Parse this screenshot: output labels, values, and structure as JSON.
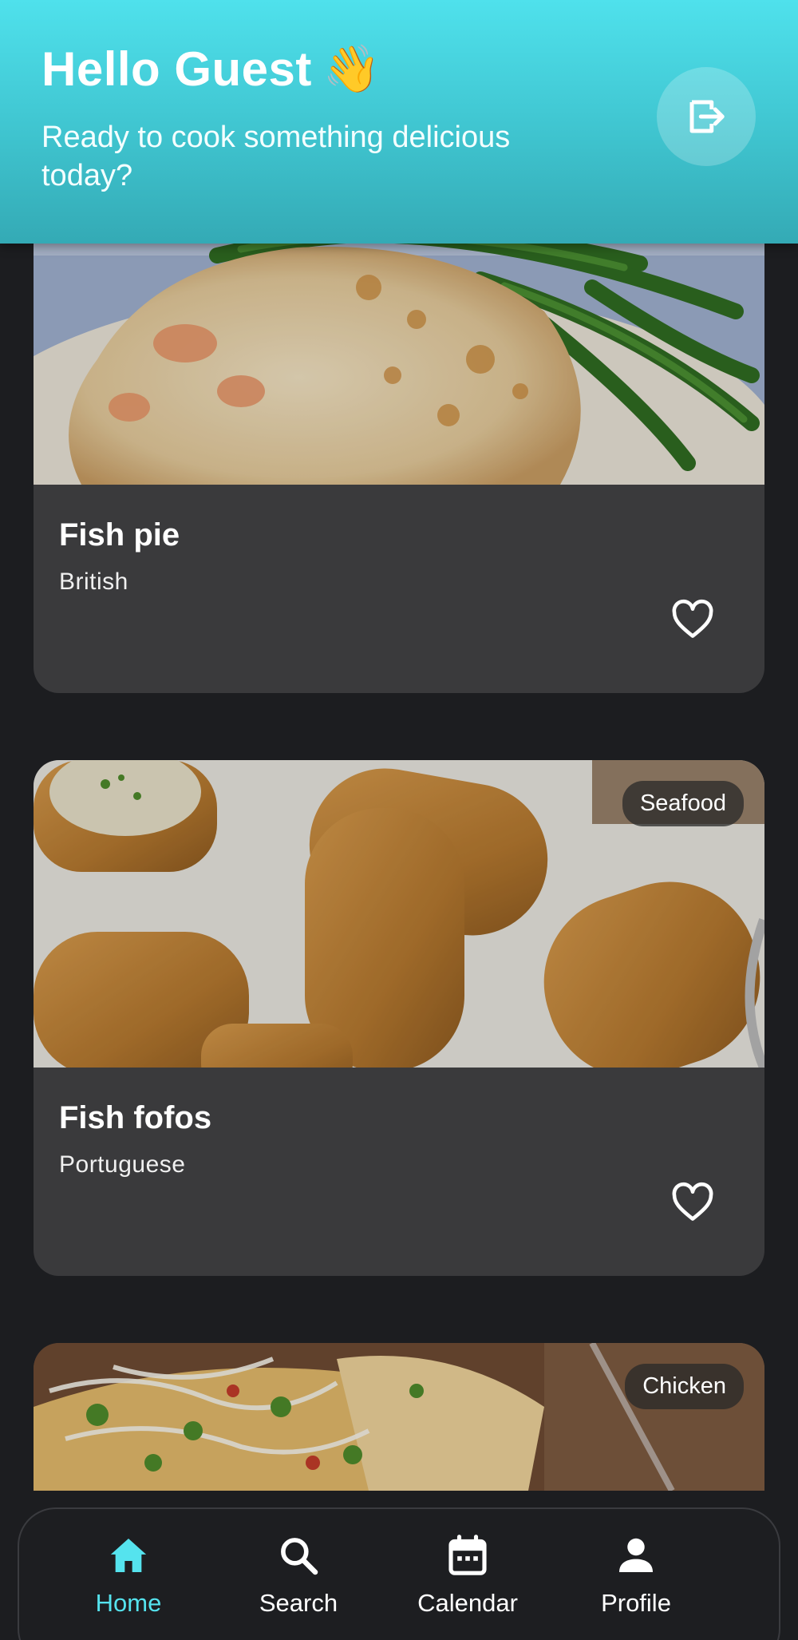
{
  "header": {
    "greeting": "Hello Guest",
    "wave_emoji": "👋",
    "subtitle": "Ready to cook something delicious today?",
    "logout_icon": "logout-icon"
  },
  "recipes": [
    {
      "title": "Fish pie",
      "cuisine": "British",
      "tag": ""
    },
    {
      "title": "Fish fofos",
      "cuisine": "Portuguese",
      "tag": "Seafood"
    },
    {
      "title": "",
      "cuisine": "",
      "tag": "Chicken"
    }
  ],
  "nav": {
    "items": [
      {
        "label": "Home",
        "icon": "home-icon",
        "active": true
      },
      {
        "label": "Search",
        "icon": "search-icon",
        "active": false
      },
      {
        "label": "Calendar",
        "icon": "calendar-icon",
        "active": false
      },
      {
        "label": "Profile",
        "icon": "profile-icon",
        "active": false
      }
    ]
  },
  "colors": {
    "header_accent": "#4fe1ec",
    "active_nav": "#55e3ee",
    "background": "#1c1d20",
    "card": "#3a3a3c"
  }
}
